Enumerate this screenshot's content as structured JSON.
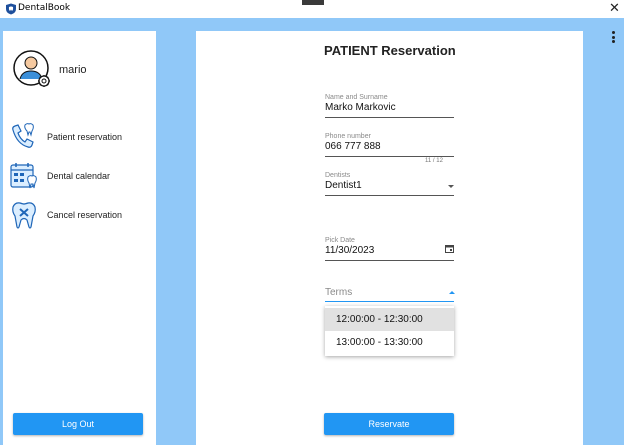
{
  "window": {
    "title": "DentalBook"
  },
  "user": {
    "name": "mario"
  },
  "sidebar": {
    "items": [
      {
        "label": "Patient reservation",
        "icon": "phone-tooth-icon"
      },
      {
        "label": "Dental calendar",
        "icon": "calendar-tooth-icon"
      },
      {
        "label": "Cancel reservation",
        "icon": "tooth-cancel-icon"
      }
    ],
    "logout_label": "Log Out"
  },
  "form": {
    "title": "PATIENT Reservation",
    "name": {
      "label": "Name and Surname",
      "value": "Marko Markovic"
    },
    "phone": {
      "label": "Phone number",
      "value": "066 777 888",
      "counter": "11 / 12"
    },
    "dentist": {
      "label": "Dentists",
      "value": "Dentist1"
    },
    "date": {
      "label": "Pick Date",
      "value": "11/30/2023"
    },
    "terms": {
      "label": "Terms",
      "options": [
        "12:00:00 - 12:30:00",
        "13:00:00 - 13:30:00"
      ]
    },
    "submit_label": "Reservate"
  },
  "colors": {
    "accent": "#2196f3",
    "background": "#90c8f8"
  }
}
